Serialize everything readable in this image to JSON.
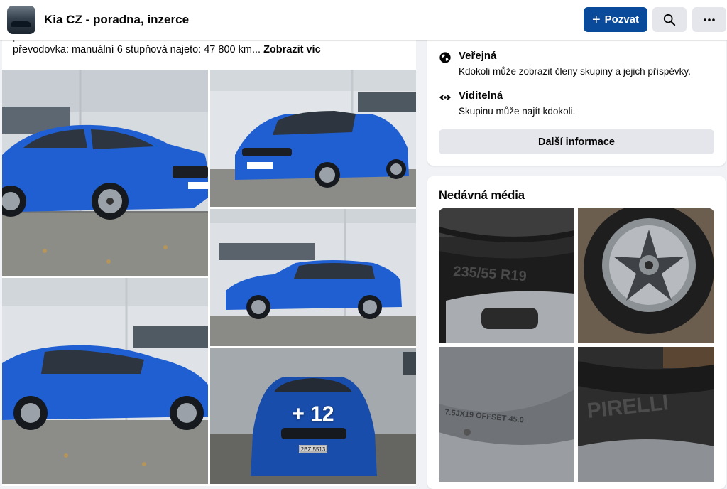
{
  "header": {
    "group_name": "Kia CZ - poradna, inzerce",
    "invite_label": "Pozvat",
    "icons": {
      "invite": "plus-icon",
      "search": "search-icon",
      "more": "more-dots-icon"
    }
  },
  "post": {
    "text_line_fuel": "palivo: diesel",
    "text_line_details": "převodovka: manuální 6 stupňová najeto: 47 800 km...",
    "see_more_label": "Zobrazit víc",
    "more_photos_count": "+ 12",
    "plate_text": "2BZ 5513"
  },
  "about": {
    "privacy_title": "Veřejná",
    "privacy_desc": "Kdokoli může zobrazit členy skupiny a jejich příspěvky.",
    "visibility_title": "Viditelná",
    "visibility_desc": "Skupinu může najít kdokoli.",
    "more_info_label": "Další informace",
    "icons": {
      "privacy": "globe-icon",
      "visibility": "eye-icon"
    }
  },
  "media": {
    "title": "Nedávná média",
    "tire_text_1": "235/55 R19",
    "tire_text_2": "7.5JX19 OFFSET 45.0",
    "tire_text_3": "PIRELLI"
  },
  "colors": {
    "accent": "#0a4a9a",
    "car_blue": "#1f5fd1",
    "page_bg": "#f0f2f5",
    "button_grey": "#e4e6eb"
  }
}
